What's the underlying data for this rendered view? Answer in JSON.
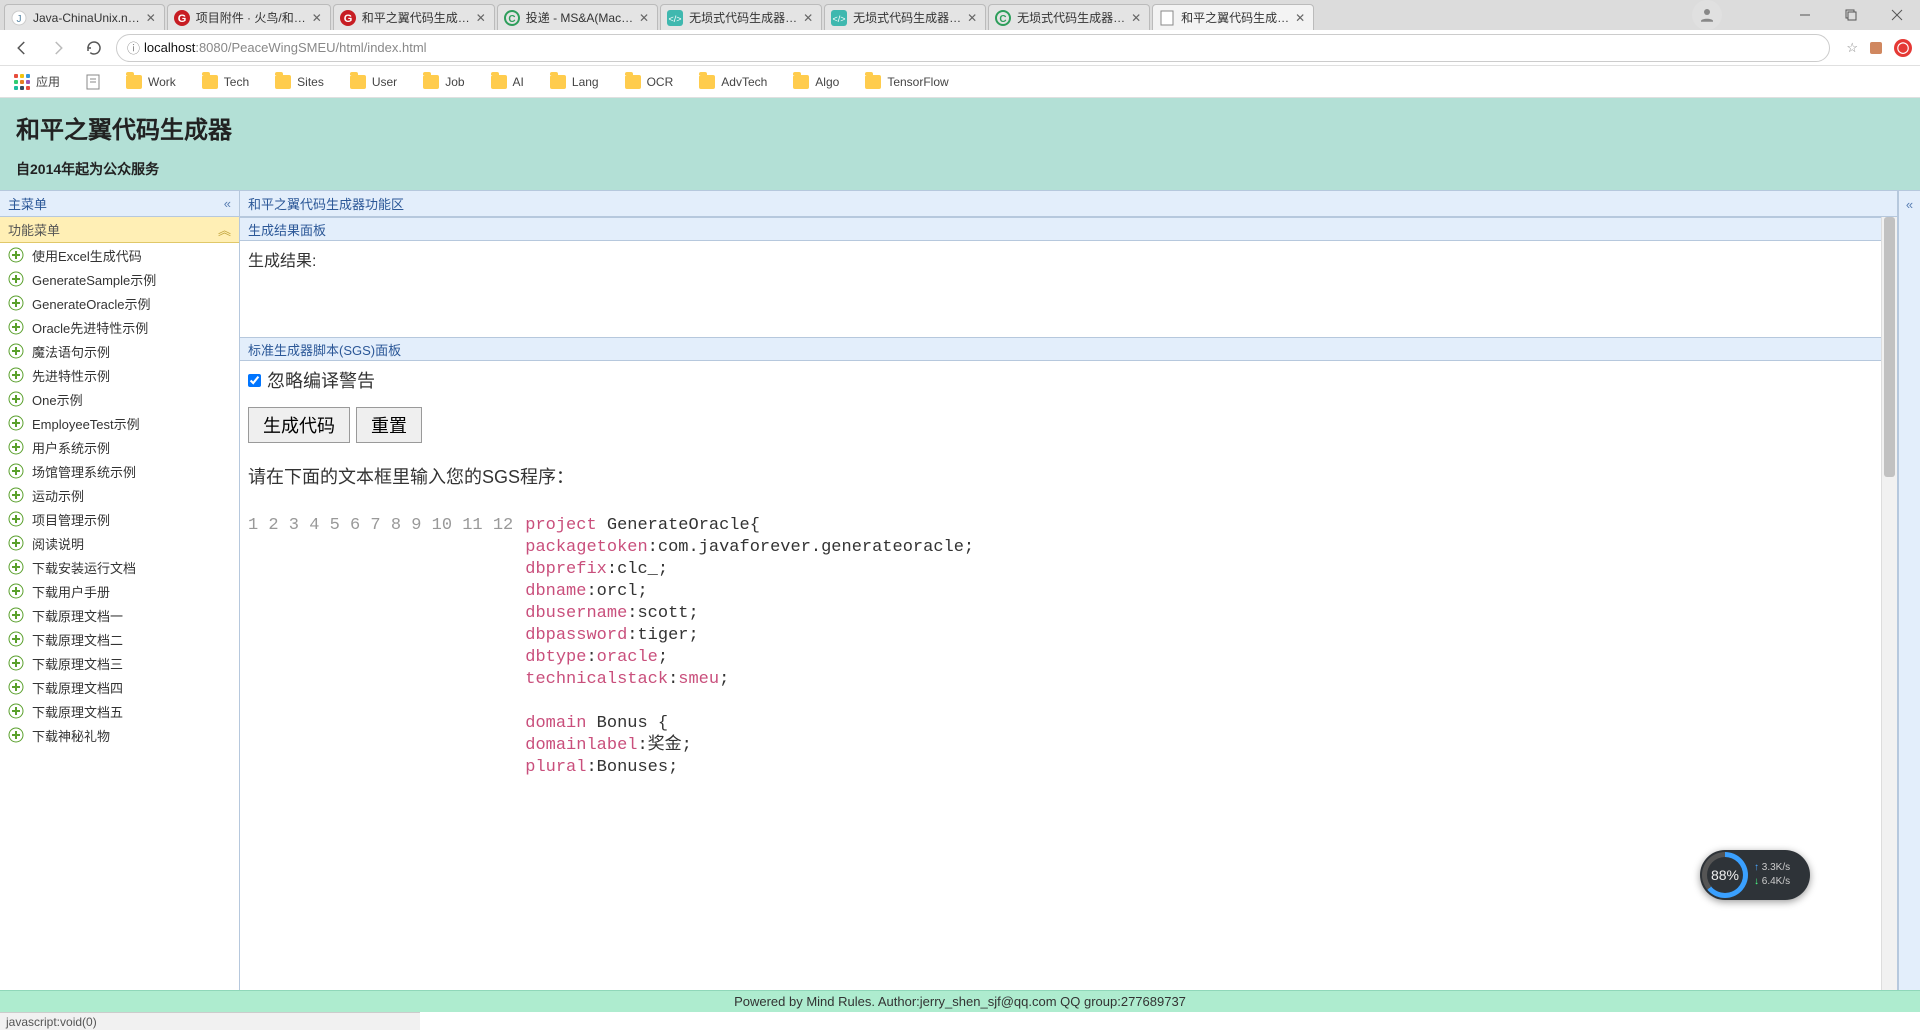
{
  "browser": {
    "tabs": [
      {
        "title": "Java-ChinaUnix.n…",
        "icon": "java"
      },
      {
        "title": "项目附件 · 火鸟/和…",
        "icon": "gitee"
      },
      {
        "title": "和平之翼代码生成…",
        "icon": "gitee"
      },
      {
        "title": "投递 - MS&A(Mac…",
        "icon": "green-c"
      },
      {
        "title": "无埙式代码生成器…",
        "icon": "teal-code"
      },
      {
        "title": "无埙式代码生成器…",
        "icon": "teal-code"
      },
      {
        "title": "无埙式代码生成器…",
        "icon": "green-c"
      },
      {
        "title": "和平之翼代码生成…",
        "icon": "page",
        "active": true
      }
    ],
    "address": {
      "protocol_icon": "ⓘ",
      "host": "localhost",
      "port": ":8080",
      "path": "/PeaceWingSMEU/html/index.html"
    },
    "bookmarks": {
      "apps_label": "应用",
      "items": [
        "Work",
        "Tech",
        "Sites",
        "User",
        "Job",
        "AI",
        "Lang",
        "OCR",
        "AdvTech",
        "Algo",
        "TensorFlow"
      ]
    }
  },
  "page": {
    "title": "和平之翼代码生成器",
    "subtitle": "自2014年起为公众服务"
  },
  "sidebar": {
    "main_menu_title": "主菜单",
    "func_menu_title": "功能菜单",
    "items": [
      "使用Excel生成代码",
      "GenerateSample示例",
      "GenerateOracle示例",
      "Oracle先进特性示例",
      "魔法语句示例",
      "先进特性示例",
      "One示例",
      "EmployeeTest示例",
      "用户系统示例",
      "场馆管理系统示例",
      "运动示例",
      "项目管理示例",
      "阅读说明",
      "下载安装运行文档",
      "下载用户手册",
      "下载原理文档一",
      "下载原理文档二",
      "下载原理文档三",
      "下载原理文档四",
      "下载原理文档五",
      "下载神秘礼物"
    ]
  },
  "center": {
    "region_title": "和平之翼代码生成器功能区",
    "result_panel_title": "生成结果面板",
    "result_label": "生成结果:",
    "sgs_panel_title": "标准生成器脚本(SGS)面板",
    "ignore_warn_label": "忽略编译警告",
    "btn_generate": "生成代码",
    "btn_reset": "重置",
    "prompt": "请在下面的文本框里输入您的SGS程序：",
    "code_lines": [
      {
        "n": 1,
        "tokens": [
          [
            "kw",
            "project"
          ],
          [
            "plain",
            " GenerateOracle{"
          ]
        ]
      },
      {
        "n": 2,
        "tokens": [
          [
            "kw",
            "packagetoken"
          ],
          [
            "plain",
            ":com.javaforever.generateoracle;"
          ]
        ]
      },
      {
        "n": 3,
        "tokens": [
          [
            "kw",
            "dbprefix"
          ],
          [
            "plain",
            ":clc_;"
          ]
        ]
      },
      {
        "n": 4,
        "tokens": [
          [
            "kw",
            "dbname"
          ],
          [
            "plain",
            ":orcl;"
          ]
        ]
      },
      {
        "n": 5,
        "tokens": [
          [
            "kw",
            "dbusername"
          ],
          [
            "plain",
            ":scott;"
          ]
        ]
      },
      {
        "n": 6,
        "tokens": [
          [
            "kw",
            "dbpassword"
          ],
          [
            "plain",
            ":tiger;"
          ]
        ]
      },
      {
        "n": 7,
        "tokens": [
          [
            "kw",
            "dbtype"
          ],
          [
            "plain",
            ":"
          ],
          [
            "val",
            "oracle"
          ],
          [
            "plain",
            ";"
          ]
        ]
      },
      {
        "n": 8,
        "tokens": [
          [
            "kw",
            "technicalstack"
          ],
          [
            "plain",
            ":"
          ],
          [
            "val",
            "smeu"
          ],
          [
            "plain",
            ";"
          ]
        ]
      },
      {
        "n": 9,
        "tokens": []
      },
      {
        "n": 10,
        "tokens": [
          [
            "kw",
            "domain"
          ],
          [
            "plain",
            " Bonus {"
          ]
        ]
      },
      {
        "n": 11,
        "tokens": [
          [
            "kw",
            "domainlabel"
          ],
          [
            "plain",
            ":奖金;"
          ]
        ]
      },
      {
        "n": 12,
        "tokens": [
          [
            "kw",
            "plural"
          ],
          [
            "plain",
            ":Bonuses;"
          ]
        ]
      }
    ]
  },
  "footer": {
    "text": "Powered by Mind Rules. Author:jerry_shen_sjf@qq.com QQ group:277689737"
  },
  "statusbar": {
    "text": "javascript:void(0)"
  },
  "net_widget": {
    "percent": "88%",
    "up": "3.3K/s",
    "down": "6.4K/s"
  }
}
